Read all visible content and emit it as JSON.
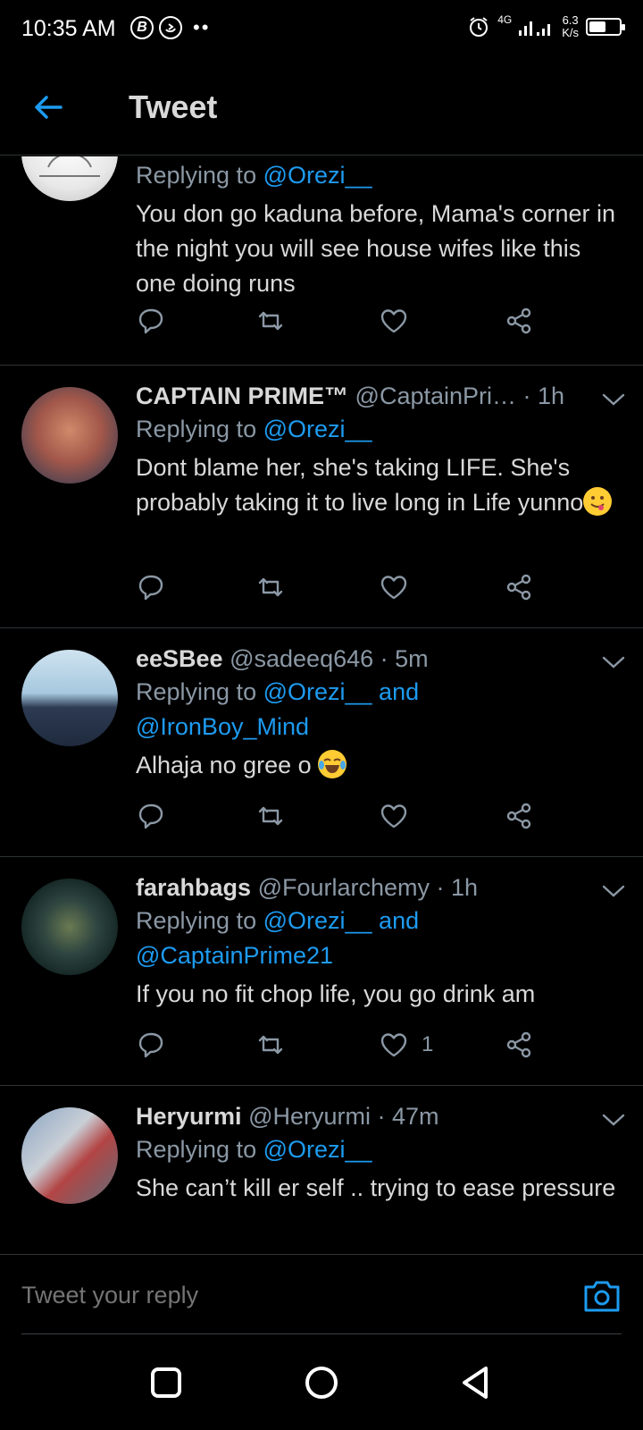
{
  "status_bar": {
    "time": "10:35 AM",
    "left_icon_1": "B",
    "network": "4G",
    "speed_value": "6.3",
    "speed_unit": "K/s",
    "battery_level": 0.55
  },
  "header": {
    "title": "Tweet"
  },
  "tweets": [
    {
      "name": "",
      "handle": "",
      "time": "",
      "replying_prefix": "Replying to",
      "mentions": "@Orezi__",
      "mentions_2": "",
      "body": "You don go kaduna before, Mama's corner in the night you will see house wifes like this one doing runs",
      "likes": ""
    },
    {
      "name": "CAPTAIN PRIME™",
      "handle": "@CaptainPri…",
      "time": "· 1h",
      "replying_prefix": "Replying to",
      "mentions": "@Orezi__",
      "mentions_2": "",
      "body": "Dont blame her, she's taking LIFE. She's probably taking it to live long in Life yunno",
      "likes": ""
    },
    {
      "name": "eeSBee",
      "handle": "@sadeeq646",
      "time": "· 5m",
      "replying_prefix": "Replying to",
      "mentions": "@Orezi__ and",
      "mentions_2": "@IronBoy_Mind",
      "body": "Alhaja no gree o",
      "likes": ""
    },
    {
      "name": "farahbags",
      "handle": "@Fourlarchemy",
      "time": "· 1h",
      "replying_prefix": "Replying to",
      "mentions": "@Orezi__ and",
      "mentions_2": "@CaptainPrime21",
      "body": "If you no fit chop life, you go drink am",
      "likes": "1"
    },
    {
      "name": "Heryurmi",
      "handle": "@Heryurmi",
      "time": "· 47m",
      "replying_prefix": "Replying to",
      "mentions": "@Orezi__",
      "mentions_2": "",
      "body": "She can’t kill er self .. trying to ease pressure",
      "likes": ""
    }
  ],
  "reply_bar": {
    "placeholder": "Tweet your reply"
  },
  "colors": {
    "accent": "#1d9bf0",
    "text": "#d9d9d9",
    "muted": "#8b98a5",
    "background": "#000000",
    "divider": "#2f3336"
  },
  "icons": {
    "back": "arrow-left-icon",
    "reply": "reply-icon",
    "retweet": "retweet-icon",
    "like": "heart-icon",
    "share": "share-icon",
    "more": "chevron-down-icon",
    "camera": "camera-icon"
  }
}
